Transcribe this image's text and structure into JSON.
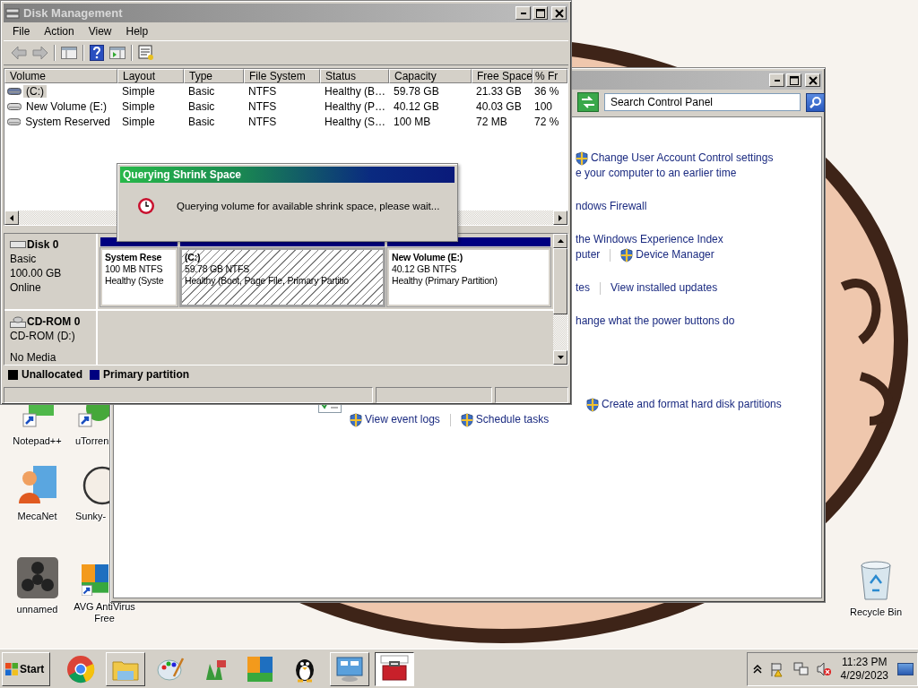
{
  "desktop": {
    "icons": [
      {
        "label": "Notepad++",
        "kind": "notepad"
      },
      {
        "label": "uTorren",
        "kind": "utorrent"
      },
      {
        "label": "MecaNet",
        "kind": "mecanet"
      },
      {
        "label": "Sunky-",
        "kind": "sunky"
      },
      {
        "label": "unnamed",
        "kind": "spinner"
      },
      {
        "label": "AVG AntiVirus Free",
        "kind": "avg"
      }
    ],
    "recycle_bin": {
      "label": "Recycle Bin"
    }
  },
  "control_panel": {
    "search": {
      "placeholder": "Search Control Panel"
    },
    "link_groups": [
      {
        "lines": [
          [
            {
              "text": "Change User Account Control settings",
              "shield": true
            }
          ],
          [
            {
              "text": "e your computer to an earlier time",
              "shield": false
            }
          ]
        ]
      },
      {
        "lines": [
          [
            {
              "text": "ndows Firewall",
              "shield": false
            }
          ]
        ]
      },
      {
        "lines": [
          [
            {
              "text": "the Windows Experience Index",
              "shield": false
            }
          ],
          [
            {
              "text": "puter",
              "shield": false
            },
            {
              "text": "Device Manager",
              "shield": true
            }
          ]
        ]
      },
      {
        "lines": [
          [
            {
              "text": "tes",
              "shield": false
            },
            {
              "text": "View installed updates",
              "shield": false
            }
          ]
        ]
      },
      {
        "lines": [
          [
            {
              "text": "hange what the power buttons do",
              "shield": false
            }
          ]
        ]
      }
    ],
    "admin_tools": {
      "lines": [
        [
          {
            "text": "Create and format hard disk partitions",
            "shield": true
          }
        ],
        [
          {
            "text": "View event logs",
            "shield": true
          },
          {
            "text": "Schedule tasks",
            "shield": true
          }
        ]
      ]
    }
  },
  "disk_management": {
    "title": "Disk Management",
    "menu": [
      "File",
      "Action",
      "View",
      "Help"
    ],
    "columns": [
      "Volume",
      "Layout",
      "Type",
      "File System",
      "Status",
      "Capacity",
      "Free Space",
      "% Fr"
    ],
    "rows": [
      {
        "selected": true,
        "cells": [
          "(C:)",
          "Simple",
          "Basic",
          "NTFS",
          "Healthy (B…",
          "59.78 GB",
          "21.33 GB",
          "36 %"
        ]
      },
      {
        "selected": false,
        "cells": [
          "New Volume (E:)",
          "Simple",
          "Basic",
          "NTFS",
          "Healthy (P…",
          "40.12 GB",
          "40.03 GB",
          "100"
        ]
      },
      {
        "selected": false,
        "cells": [
          "System Reserved",
          "Simple",
          "Basic",
          "NTFS",
          "Healthy (S…",
          "100 MB",
          "72 MB",
          "72 %"
        ]
      }
    ],
    "disks": [
      {
        "kind": "disk",
        "name": "Disk 0",
        "details": [
          "Basic",
          "100.00 GB",
          "Online"
        ],
        "partitions": [
          {
            "name": "System Rese",
            "size": "100 MB NTFS",
            "status": "Healthy (Syste",
            "selected": false
          },
          {
            "name": "(C:)",
            "size": "59.78 GB NTFS",
            "status": "Healthy (Boot, Page File, Primary Partitio",
            "selected": true
          },
          {
            "name": "New Volume  (E:)",
            "size": "40.12 GB NTFS",
            "status": "Healthy (Primary Partition)",
            "selected": false
          }
        ]
      },
      {
        "kind": "cdrom",
        "name": "CD-ROM 0",
        "details": [
          "CD-ROM (D:)",
          "No Media"
        ]
      }
    ],
    "legend": [
      {
        "label": "Unallocated",
        "color": "#000000"
      },
      {
        "label": "Primary partition",
        "color": "#000080"
      }
    ]
  },
  "dialog": {
    "title": "Querying Shrink Space",
    "message": "Querying volume for available shrink space, please wait..."
  },
  "taskbar": {
    "start": "Start",
    "apps": [
      {
        "kind": "chrome",
        "open": false,
        "selected": false
      },
      {
        "kind": "explorer",
        "open": true,
        "selected": false
      },
      {
        "kind": "paint",
        "open": false,
        "selected": false
      },
      {
        "kind": "plant",
        "open": false,
        "selected": false
      },
      {
        "kind": "avg",
        "open": false,
        "selected": false
      },
      {
        "kind": "penguin",
        "open": false,
        "selected": false
      },
      {
        "kind": "control_panel",
        "open": true,
        "selected": false
      },
      {
        "kind": "toolbox",
        "open": true,
        "selected": true
      }
    ],
    "clock": {
      "time": "11:23 PM",
      "date": "4/29/2023"
    }
  }
}
